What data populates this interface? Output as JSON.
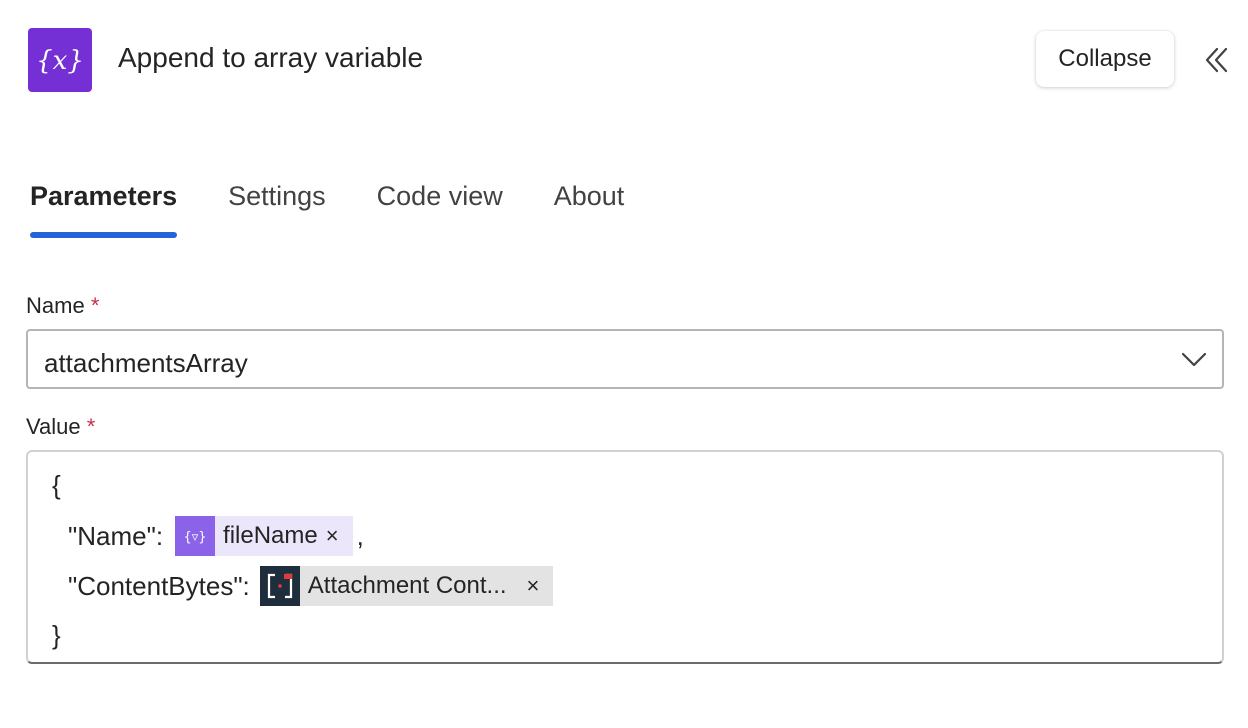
{
  "header": {
    "title": "Append to array variable",
    "icon_glyph": "{x}",
    "collapse_label": "Collapse",
    "accent_color": "#7430d5"
  },
  "tabs": [
    {
      "label": "Parameters",
      "active": true
    },
    {
      "label": "Settings",
      "active": false
    },
    {
      "label": "Code view",
      "active": false
    },
    {
      "label": "About",
      "active": false
    }
  ],
  "name_field": {
    "label": "Name",
    "required_marker": "*",
    "value": "attachmentsArray"
  },
  "value_field": {
    "label": "Value",
    "required_marker": "*",
    "open_brace": "{",
    "close_brace": "}",
    "lines": [
      {
        "key": "\"Name\":",
        "token_label": "fileName",
        "token_type": "variable",
        "suffix": ","
      },
      {
        "key": "\"ContentBytes\":",
        "token_label": "Attachment Cont...",
        "token_type": "attachment",
        "suffix": ""
      }
    ],
    "remove_glyph": "×"
  },
  "colors": {
    "tab_underline": "#2563d9",
    "required": "#c4314b",
    "variable_token_bg": "#ece6fb",
    "variable_icon_bg": "#8a63e9",
    "attachment_token_bg": "#e3e3e3",
    "attachment_icon_bg": "#1f2e3d"
  }
}
